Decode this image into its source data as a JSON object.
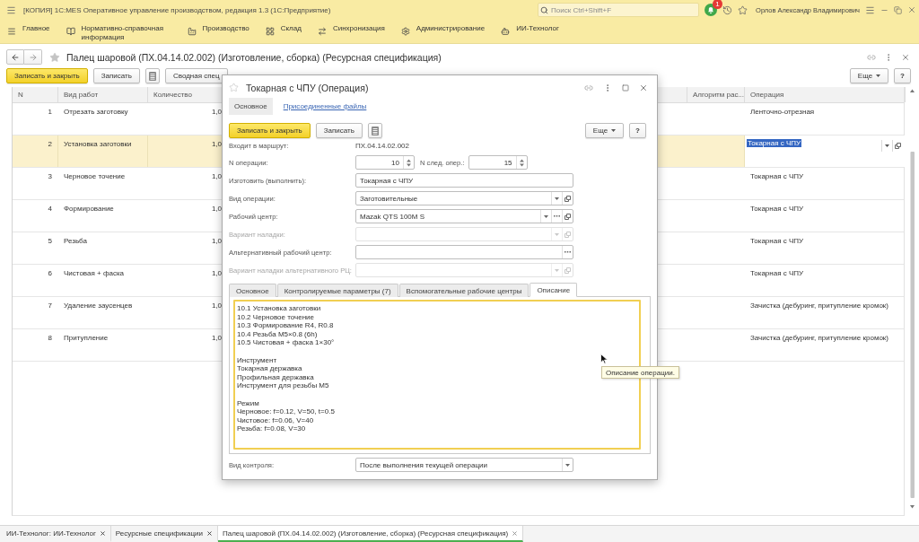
{
  "window": {
    "title": "[КОПИЯ] 1С:MES Оперативное управление производством, редакция 1.3 (1С:Предприятие)",
    "search": {
      "placeholder": "Поиск Ctrl+Shift+F"
    },
    "notifications": "1",
    "user": "Орлов Александр Владимирович"
  },
  "sections": [
    {
      "label": "Главное"
    },
    {
      "label": "Нормативно-справочная информация"
    },
    {
      "label": "Производство"
    },
    {
      "label": "Склад"
    },
    {
      "label": "Синхронизация"
    },
    {
      "label": "Администрирование"
    },
    {
      "label": "ИИ-Технолог"
    }
  ],
  "document": {
    "title": "Палец шаровой (ПХ.04.14.02.002) (Изготовление, сборка) (Ресурсная спецификация)",
    "toolbar": {
      "buttons": [
        {
          "kind": "primary",
          "label": "Записать и закрыть"
        },
        {
          "kind": "default",
          "label": "Записать"
        },
        {
          "kind": "icon"
        },
        {
          "kind": "default",
          "label": "Сводная спец"
        }
      ],
      "more": "Еще",
      "help": "?"
    },
    "table": {
      "columns": [
        {
          "label": "N"
        },
        {
          "label": "Вид работ"
        },
        {
          "label": "Количество"
        },
        {
          "label": "Алгоритм рас..."
        },
        {
          "label": "Операция"
        }
      ],
      "rows": [
        {
          "n": "1",
          "work": "Отрезать заготовку",
          "quantity": "1,0",
          "operation": "Ленточно-отрезная",
          "selected": false,
          "editing": false
        },
        {
          "n": "2",
          "work": "Установка заготовки",
          "quantity": "1,0",
          "operation": "Токарная с ЧПУ",
          "selected": true,
          "editing": true
        },
        {
          "n": "3",
          "work": "Черновое точение",
          "quantity": "1,0",
          "operation": "Токарная с ЧПУ",
          "selected": false,
          "editing": false
        },
        {
          "n": "4",
          "work": "Формирование",
          "quantity": "1,0",
          "operation": "Токарная с ЧПУ",
          "selected": false,
          "editing": false
        },
        {
          "n": "5",
          "work": "Резьба",
          "quantity": "1,0",
          "operation": "Токарная с ЧПУ",
          "selected": false,
          "editing": false
        },
        {
          "n": "6",
          "work": "Чистовая + фаска",
          "quantity": "1,0",
          "operation": "Токарная с ЧПУ",
          "selected": false,
          "editing": false
        },
        {
          "n": "7",
          "work": "Удаление заусенцев",
          "quantity": "1,0",
          "operation": "Зачистка (дебуринг, притупление кромок)",
          "selected": false,
          "editing": false
        },
        {
          "n": "8",
          "work": "Притупление",
          "quantity": "1,0",
          "operation": "Зачистка (дебуринг, притупление кромок)",
          "selected": false,
          "editing": false
        }
      ]
    }
  },
  "dialog": {
    "title": "Токарная с ЧПУ (Операция)",
    "pages": [
      {
        "label": "Основное",
        "selected": true
      },
      {
        "label": "Присоединенные файлы",
        "selected": false
      }
    ],
    "toolbar": {
      "buttons": [
        {
          "kind": "primary",
          "label": "Записать и закрыть"
        },
        {
          "kind": "default",
          "label": "Записать"
        },
        {
          "kind": "icon"
        }
      ],
      "more": "Еще",
      "help": "?"
    },
    "fields": [
      {
        "kind": "static",
        "label": "Входит в маршрут:",
        "value": "ПХ.04.14.02.002"
      },
      {
        "kind": "pair",
        "label": "N операции:",
        "value": "10",
        "next_label": "N след. опер.:",
        "next_value": "15"
      },
      {
        "kind": "input",
        "label": "Изготовить (выполнить):",
        "value": "Токарная с ЧПУ",
        "disabled": false,
        "dropdown": false,
        "choose": false,
        "open": false
      },
      {
        "kind": "input",
        "label": "Вид операции:",
        "value": "Заготовительные",
        "disabled": false,
        "dropdown": true,
        "choose": false,
        "open": true
      },
      {
        "kind": "input",
        "label": "Рабочий центр:",
        "value": "Mazak QTS 100M S",
        "disabled": false,
        "dropdown": true,
        "choose": true,
        "open": true
      },
      {
        "kind": "input",
        "label": "Вариант наладки:",
        "disabled": true,
        "dropdown": true,
        "choose": false,
        "open": true
      },
      {
        "kind": "input",
        "label": "Альтернативный рабочий центр:",
        "disabled": false,
        "dropdown": false,
        "choose": true,
        "open": false
      },
      {
        "kind": "input",
        "label": "Вариант наладки альтернативного РЦ:",
        "disabled": true,
        "dropdown": true,
        "choose": false,
        "open": true
      }
    ],
    "tabs": [
      {
        "label": "Основное",
        "selected": false
      },
      {
        "label": "Контролируемые параметры (7)",
        "selected": false
      },
      {
        "label": "Вспомогательные рабочие центры",
        "selected": false
      },
      {
        "label": "Описание",
        "selected": true
      }
    ],
    "description": "10.1 Установка заготовки\n10.2 Черновое точение\n10.3 Формирование R4, R0.8\n10.4 Резьба M5×0.8 (6h)\n10.5 Чистовая + фаска 1×30°\n\nИнструмент\nТокарная державка\nПрофильная державка\nИнструмент для резьбы M5\n\nРежим\nЧерновое: f=0.12, V=50, t=0.5\nЧистовое: f=0.06, V=40\nРезьба: f=0.08, V=30",
    "control_field": {
      "label": "Вид контроля:",
      "value": "После выполнения текущей операции",
      "disabled": false,
      "dropdown": true,
      "choose": false,
      "open": false
    }
  },
  "tooltip": "Описание операции.",
  "open_windows": [
    {
      "label": "ИИ-Технолог: ИИ-Технолог",
      "selected": false
    },
    {
      "label": "Ресурсные спецификации",
      "selected": false
    },
    {
      "label": "Палец шаровой (ПХ.04.14.02.002) (Изготовление, сборка) (Ресурсная спецификация)",
      "selected": true
    }
  ]
}
